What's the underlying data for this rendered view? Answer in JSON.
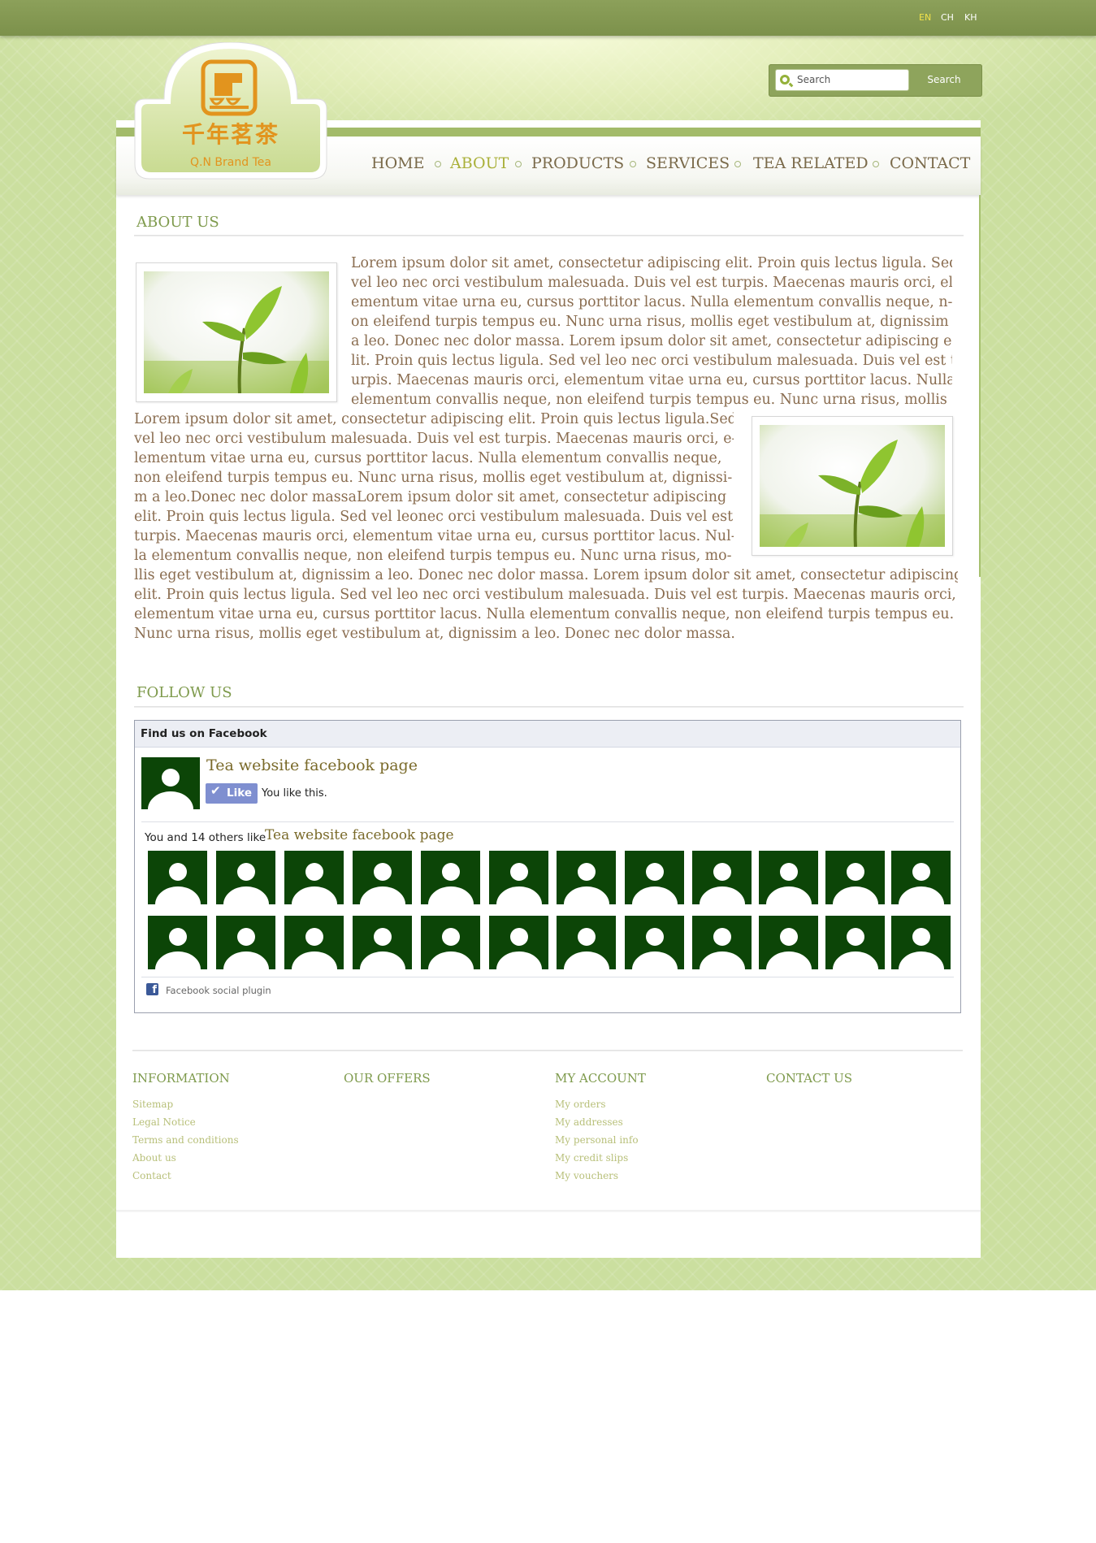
{
  "languages": [
    {
      "code": "EN",
      "active": true
    },
    {
      "code": "CH",
      "active": false
    },
    {
      "code": "KH",
      "active": false
    }
  ],
  "search": {
    "placeholder": "Search",
    "button_label": "Search"
  },
  "logo": {
    "chinese": "千年茗茶",
    "english": "Q.N Brand Tea"
  },
  "nav": [
    {
      "label": "HOME",
      "active": false
    },
    {
      "label": "ABOUT",
      "active": true
    },
    {
      "label": "PRODUCTS",
      "active": false
    },
    {
      "label": "SERVICES",
      "active": false
    },
    {
      "label": "TEA RELATED",
      "active": false
    },
    {
      "label": "CONTACT",
      "active": false
    }
  ],
  "about": {
    "title": "ABOUT US",
    "lines_a": [
      "Lorem ipsum dolor sit amet, consectetur adipiscing elit. Proin quis lectus ligula. Sed",
      "vel leo nec orci vestibulum malesuada. Duis vel est turpis. Maecenas mauris orci, el-",
      "ementum vitae urna eu, cursus porttitor lacus. Nulla elementum convallis neque, n-",
      "on eleifend turpis tempus eu. Nunc urna risus, mollis eget vestibulum at,  dignissim",
      "a leo. Donec nec dolor massa. Lorem ipsum dolor sit amet, consectetur adipiscing e-",
      "lit. Proin quis lectus ligula. Sed vel leo nec orci vestibulum malesuada. Duis vel est t-",
      "urpis. Maecenas mauris orci, elementum vitae urna eu, cursus porttitor lacus.  Nulla",
      "elementum convallis neque, non eleifend turpis tempus eu. Nunc urna risus,  mollis"
    ],
    "lines_b": [
      "Lorem ipsum dolor sit amet, consectetur adipiscing elit. Proin quis lectus ligula.Sed",
      "vel leo nec orci vestibulum malesuada. Duis vel est turpis. Maecenas mauris orci, e-",
      "lementum vitae urna eu, cursus porttitor lacus. Nulla elementum  convallis   neque,",
      "non eleifend turpis tempus eu. Nunc urna risus, mollis eget vestibulum at, dignissi-",
      "m  a  leo.Donec nec dolor massaLorem ipsum dolor sit amet, consectetur adipiscing",
      "elit. Proin quis lectus ligula. Sed vel leonec orci vestibulum malesuada. Duis vel   est",
      "turpis. Maecenas mauris orci, elementum vitae urna eu, cursus porttitor lacus. Nul-",
      "la elementum convallis neque, non eleifend turpis tempus eu. Nunc urna risus, mo-"
    ],
    "lines_c": [
      "llis eget vestibulum at, dignissim a leo. Donec nec dolor massa. Lorem ipsum dolor sit amet, consectetur adipiscing",
      "elit. Proin quis lectus ligula. Sed vel leo nec orci vestibulum malesuada. Duis vel est turpis.  Maecenas  mauris  orci,",
      "elementum vitae urna eu, cursus porttitor lacus. Nulla elementum convallis neque, non eleifend turpis  tempus  eu.",
      "Nunc urna risus, mollis eget vestibulum at, dignissim a leo. Donec nec dolor massa."
    ]
  },
  "follow": {
    "title": "FOLLOW US",
    "facebook": {
      "header": "Find us on Facebook",
      "page_name": "Tea website facebook page",
      "like_label": "Like",
      "you_like": "You like this.",
      "others_prefix": "You and 14 others like",
      "others_page": "Tea website facebook page",
      "plugin_label": "Facebook social plugin",
      "fan_count": 24
    }
  },
  "footer": {
    "columns": [
      {
        "title": "INFORMATION",
        "links": [
          "Sitemap",
          "Legal Notice",
          "Terms and conditions",
          "About us",
          "Contact"
        ]
      },
      {
        "title": "OUR OFFERS",
        "links": []
      },
      {
        "title": "MY ACCOUNT",
        "links": [
          "My orders",
          "My addresses",
          "My personal info",
          "My credit slips",
          "My vouchers"
        ]
      },
      {
        "title": "CONTACT US",
        "links": []
      }
    ]
  },
  "colors": {
    "top_bar": "#7c914b",
    "background": "#cbdf9f",
    "heading_green": "#7e9a4c",
    "nav_active": "#aab03a",
    "body_text": "#8a6d50",
    "facebook_avatar": "#0c4507",
    "footer_link": "#b8c07a"
  }
}
